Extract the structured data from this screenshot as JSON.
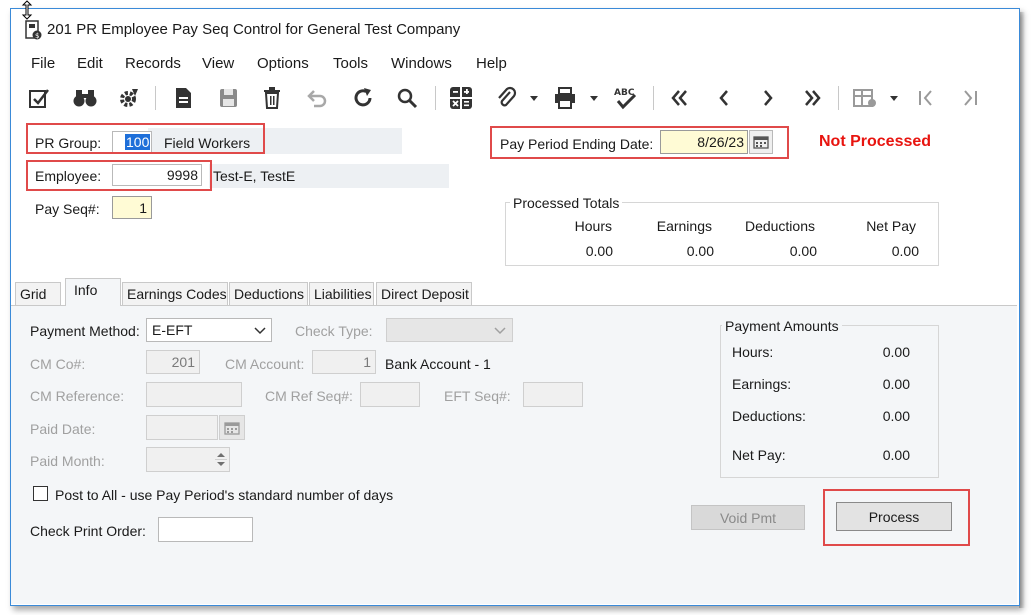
{
  "window": {
    "title": "201 PR Employee Pay Seq Control for General Test Company"
  },
  "menu": [
    "File",
    "Edit",
    "Records",
    "View",
    "Options",
    "Tools",
    "Windows",
    "Help"
  ],
  "colors": {
    "red_highlight": "#e04a4a",
    "status_red": "#e8140f",
    "required_yellow": "#fffbd5",
    "panel_bg": "#f4f6f8"
  },
  "toolbar": [
    "checklist-icon",
    "binoculars-icon",
    "gear-icon",
    "document-icon",
    "save-icon",
    "trash-icon",
    "undo-icon",
    "refresh-icon",
    "search-icon",
    "calculator-icon",
    "paperclip-icon",
    "print-icon",
    "spellcheck-icon",
    "first-record-icon",
    "prev-record-icon",
    "next-record-icon",
    "last-record-icon",
    "grid-settings-icon",
    "nav-first-icon",
    "nav-last-icon"
  ],
  "header": {
    "pr_group_label": "PR Group:",
    "pr_group_value": "100",
    "pr_group_desc": "Field Workers",
    "employee_label": "Employee:",
    "employee_value": "9998",
    "employee_name": "Test-E, TestE",
    "pay_seq_label": "Pay Seq#:",
    "pay_seq_value": "1",
    "pay_period_label": "Pay Period Ending Date:",
    "pay_period_value": "8/26/23",
    "status": "Not Processed"
  },
  "processed_totals": {
    "title": "Processed Totals",
    "columns": [
      "Hours",
      "Earnings",
      "Deductions",
      "Net Pay"
    ],
    "values": [
      "0.00",
      "0.00",
      "0.00",
      "0.00"
    ]
  },
  "tabs": [
    "Grid",
    "Info",
    "Earnings Codes",
    "Deductions",
    "Liabilities",
    "Direct Deposit"
  ],
  "info": {
    "payment_method_label": "Payment Method:",
    "payment_method_value": "E-EFT",
    "check_type_label": "Check Type:",
    "check_type_value": "",
    "cm_co_label": "CM Co#:",
    "cm_co_value": "201",
    "cm_account_label": "CM Account:",
    "cm_account_value": "1",
    "cm_account_desc": "Bank Account - 1",
    "cm_reference_label": "CM Reference:",
    "cm_ref_seq_label": "CM Ref Seq#:",
    "eft_seq_label": "EFT Seq#:",
    "paid_date_label": "Paid Date:",
    "paid_month_label": "Paid Month:",
    "post_to_all_label": "Post to All - use Pay Period's standard number of days",
    "post_to_all_checked": false,
    "check_print_order_label": "Check Print Order:"
  },
  "payment_amounts": {
    "title": "Payment Amounts",
    "rows": [
      {
        "label": "Hours:",
        "value": "0.00"
      },
      {
        "label": "Earnings:",
        "value": "0.00"
      },
      {
        "label": "Deductions:",
        "value": "0.00"
      },
      {
        "label": "Net Pay:",
        "value": "0.00"
      }
    ]
  },
  "buttons": {
    "void_pmt": "Void Pmt",
    "process": "Process"
  }
}
